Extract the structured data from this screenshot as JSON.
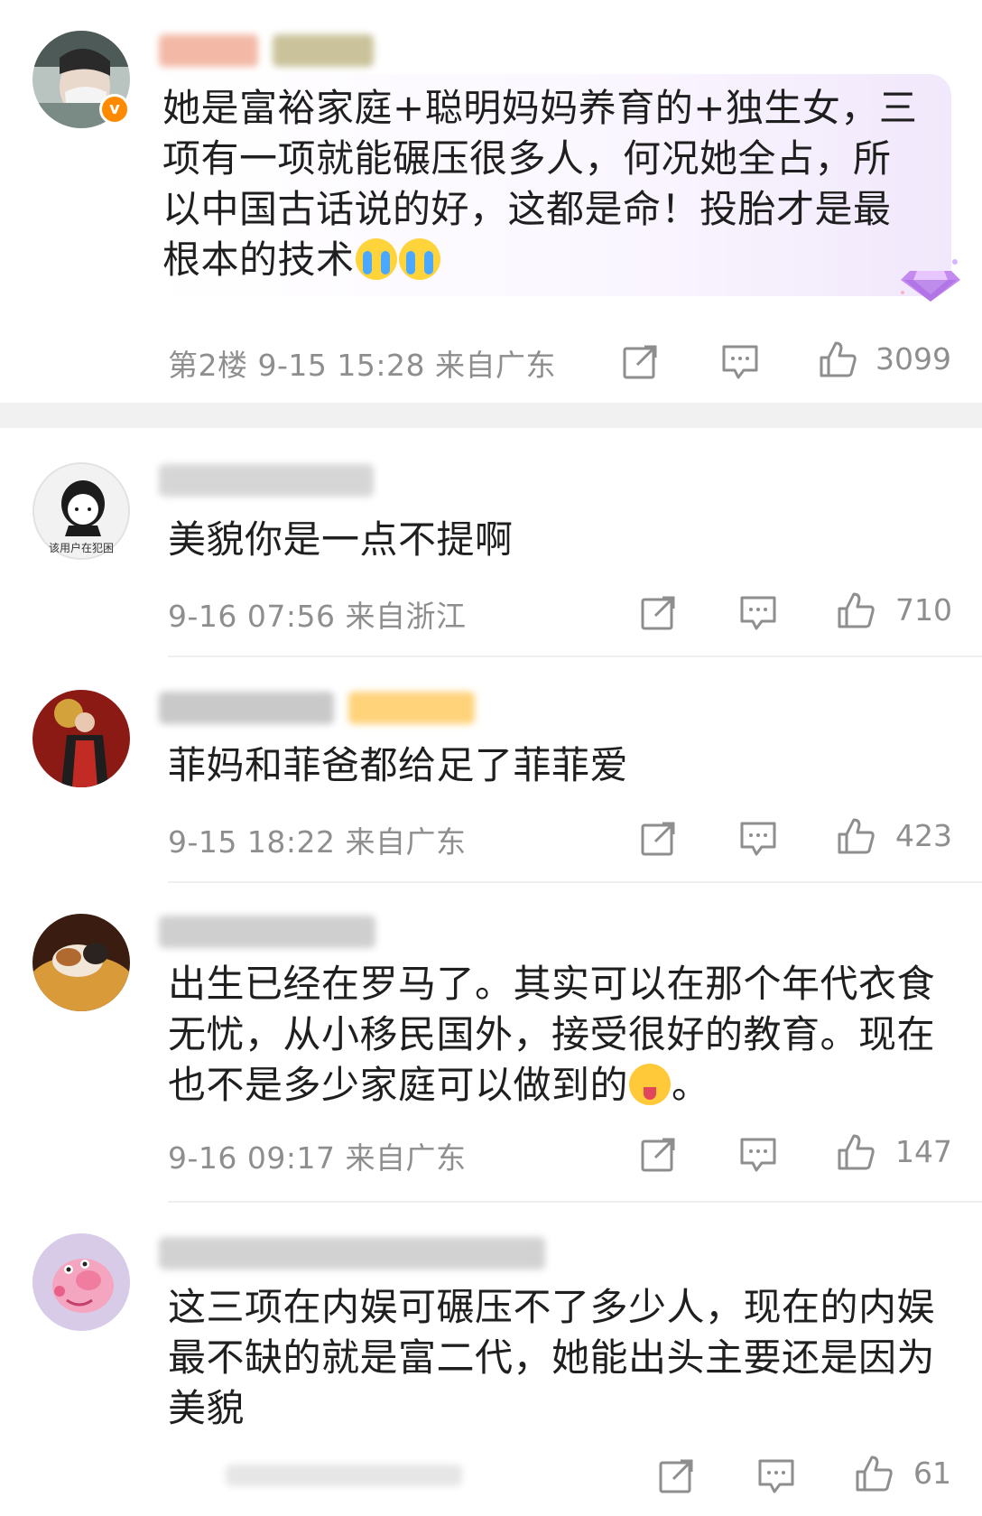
{
  "colors": {
    "meta_gray": "#8e8e8e",
    "verified_orange": "#ff8a00",
    "bubble_purple": "#f1e8fb"
  },
  "comments": [
    {
      "text": "她是富裕家庭+聪明妈妈养育的+独生女，三项有一项就能碾压很多人，何况她全占，所以中国古话说的好，这都是命！投胎才是最根本的技术",
      "lines": [
        "她是富裕家庭+聪明妈妈养育的+独生女，三",
        "项有一项就能碾压很多人，何况她全占，所",
        "以中国古话说的好，这都是命！投胎才是最",
        "根本的技术"
      ],
      "emoji": [
        "crying-face",
        "crying-face"
      ],
      "floor": "第2楼",
      "time": "9-15 15:28",
      "location": "来自广东",
      "likes": "3099",
      "verified": true,
      "fan_badge_icon": "diamond-icon"
    },
    {
      "text": "美貌你是一点不提啊",
      "lines": [
        "美貌你是一点不提啊"
      ],
      "avatar_label": "该用户在犯困",
      "time": "9-16 07:56",
      "location": "来自浙江",
      "likes": "710"
    },
    {
      "text": "菲妈和菲爸都给足了菲菲爱",
      "lines": [
        "菲妈和菲爸都给足了菲菲爱"
      ],
      "time": "9-15 18:22",
      "location": "来自广东",
      "likes": "423"
    },
    {
      "text": "出生已经在罗马了。其实可以在那个年代衣食无忧，从小移民国外，接受很好的教育。现在也不是多少家庭可以做到的。",
      "lines": [
        "出生已经在罗马了。其实可以在那个年代衣食",
        "无忧，从小移民国外，接受很好的教育。现在",
        "也不是多少家庭可以做到的",
        "。"
      ],
      "emoji": [
        "tongue-face"
      ],
      "time": "9-16 09:17",
      "location": "来自广东",
      "likes": "147"
    },
    {
      "text": "这三项在内娱可碾压不了多少人，现在的内娱最不缺的就是富二代，她能出头主要还是因为美貌",
      "lines": [
        "这三项在内娱可碾压不了多少人，现在的内娱",
        "最不缺的就是富二代，她能出头主要还是因为",
        "美貌"
      ],
      "likes": "61"
    }
  ],
  "icons": {
    "share": "share-icon",
    "reply": "comment-icon",
    "like": "thumbs-up-icon"
  }
}
